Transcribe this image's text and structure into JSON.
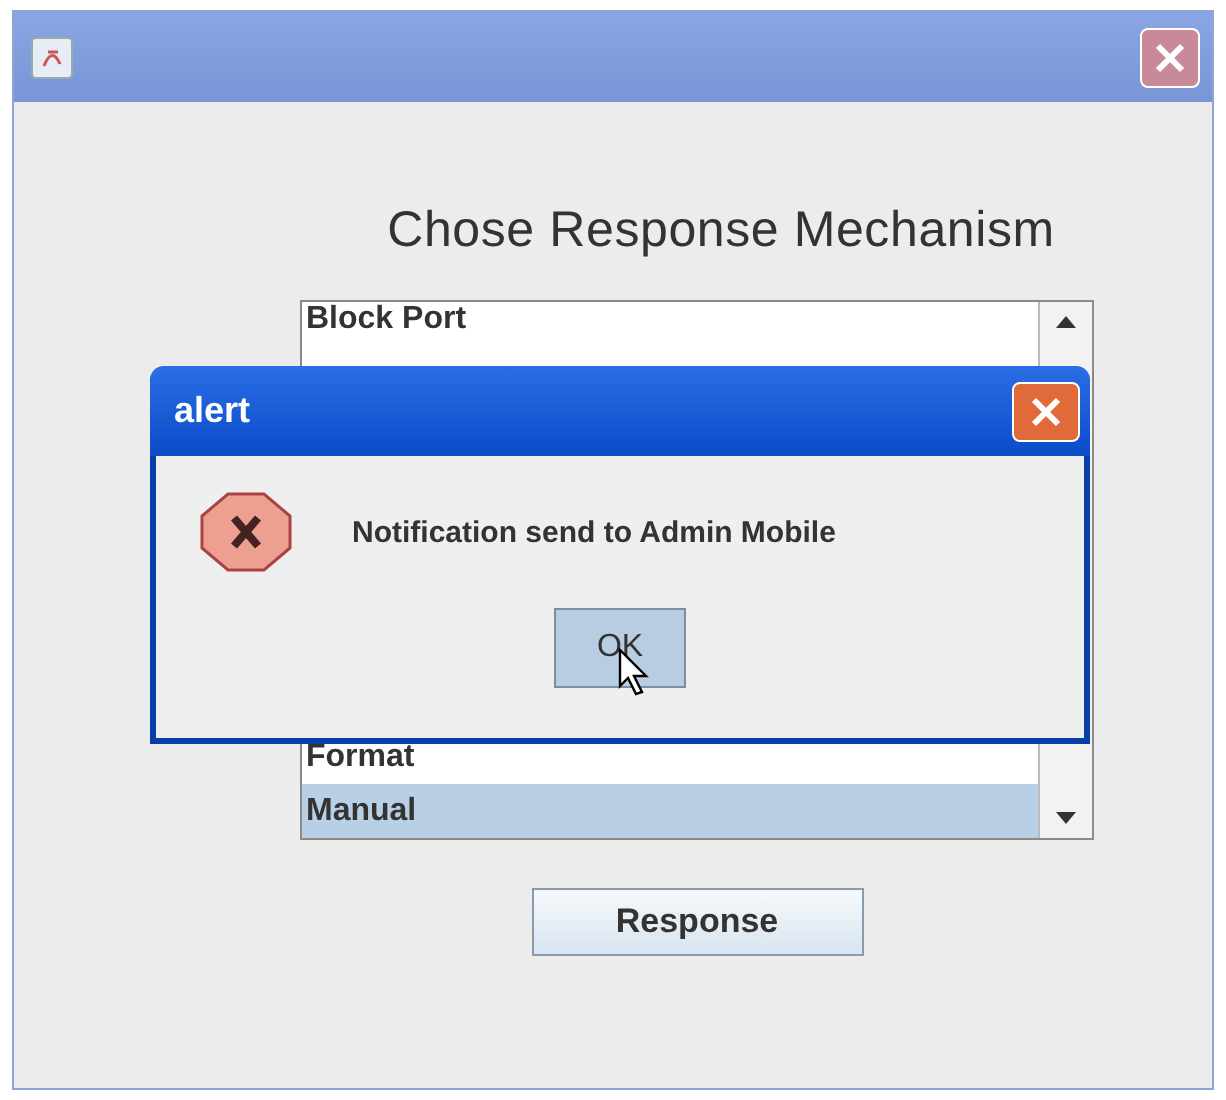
{
  "window": {
    "heading": "Chose Response Mechanism"
  },
  "list": {
    "items": [
      {
        "label": "Block Port",
        "selected": false
      },
      {
        "label": "Format",
        "selected": false
      },
      {
        "label": "Manual",
        "selected": true
      }
    ]
  },
  "buttons": [
    "Response"
  ],
  "dialog": {
    "title": "alert",
    "message": "Notification send to Admin Mobile",
    "button": "OK"
  }
}
